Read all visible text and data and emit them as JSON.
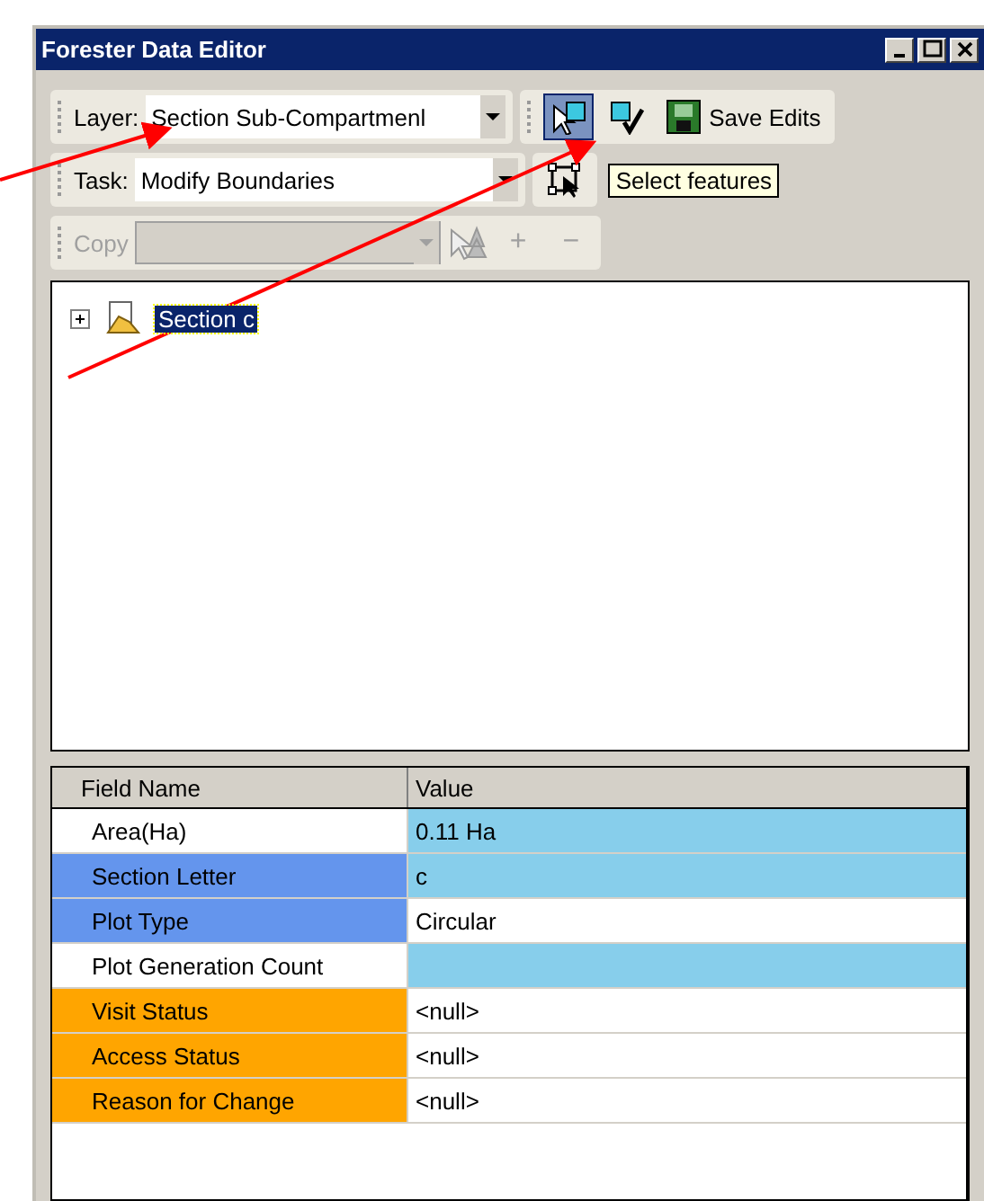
{
  "window": {
    "title": "Forester Data Editor"
  },
  "toolbar_layer": {
    "label": "Layer:",
    "value": "Section Sub-Compartmenl",
    "tools": [
      {
        "kind": "select",
        "selected": true
      },
      {
        "kind": "validate",
        "selected": false
      },
      {
        "kind": "save",
        "label": "Save Edits",
        "selected": false
      }
    ]
  },
  "toolbar_task": {
    "label": "Task:",
    "value": "Modify Boundaries",
    "tooltip": "Select features"
  },
  "toolbar_copy": {
    "label": "Copy",
    "disabled": true,
    "plus": "+",
    "minus": "−"
  },
  "tree": {
    "items": [
      {
        "label": "Section c",
        "selected": true,
        "expanded": false
      }
    ]
  },
  "table": {
    "columns": [
      "Field Name",
      "Value"
    ],
    "rows": [
      {
        "field": {
          "text": "Area(Ha)",
          "color": "#ffffff"
        },
        "value": {
          "text": "0.11 Ha",
          "color": "#87ceeb"
        }
      },
      {
        "field": {
          "text": "Section Letter",
          "color": "#6495ed"
        },
        "value": {
          "text": "c",
          "color": "#87ceeb"
        }
      },
      {
        "field": {
          "text": "Plot Type",
          "color": "#6495ed"
        },
        "value": {
          "text": "Circular",
          "color": "#ffffff"
        }
      },
      {
        "field": {
          "text": "Plot Generation Count",
          "color": "#ffffff"
        },
        "value": {
          "color": "#87ceeb"
        }
      },
      {
        "field": {
          "text": "Visit Status",
          "color": "#ffa500"
        },
        "value": {
          "text": "<null>",
          "color": "#ffffff"
        }
      },
      {
        "field": {
          "text": "Access Status",
          "color": "#ffa500"
        },
        "value": {
          "text": "<null>",
          "color": "#ffffff"
        }
      },
      {
        "field": {
          "text": "Reason for Change",
          "color": "#ffa500"
        },
        "value": {
          "text": "<null>",
          "color": "#ffffff"
        }
      }
    ]
  }
}
